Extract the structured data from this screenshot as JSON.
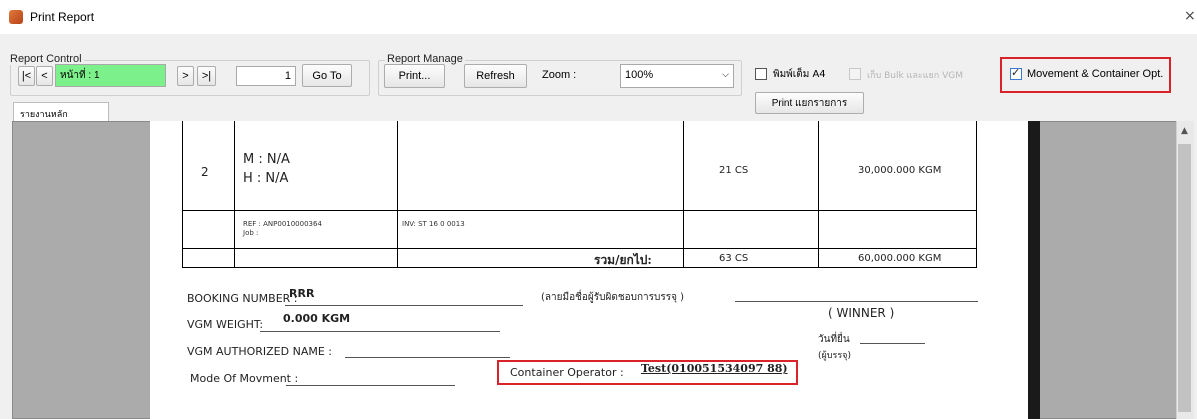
{
  "window": {
    "title": "Print Report",
    "close_glyph": "×"
  },
  "report_control": {
    "title": "Report Control",
    "first_glyph": "|<",
    "prev_glyph": "<",
    "next_glyph": ">",
    "last_glyph": ">|",
    "page_label": "หน้าที่ : 1",
    "page_input": "1",
    "goto_label": "Go To"
  },
  "report_manage": {
    "title": "Report Manage",
    "print_label": "Print...",
    "refresh_label": "Refresh",
    "zoom_label": "Zoom :",
    "zoom_value": "100%"
  },
  "options": {
    "a4_label": "พิมพ์เต็ม A4",
    "bulk_label": "เก็บ Bulk และแยก VGM",
    "print_list_label": "Print แยกรายการ",
    "movement_label": "Movement & Container Opt."
  },
  "tab": {
    "label": "รายงานหลัก"
  },
  "document": {
    "row_no": "2",
    "m_text": "M : N/A",
    "h_text": "H : N/A",
    "row_qty": "21  CS",
    "row_weight": "30,000.000  KGM",
    "ref_text": "REF : ANP0010000364",
    "job_text": "Job :",
    "inv_text": "INV: ST 16 0 0013",
    "total_label": "รวม/ยกไป:",
    "total_qty": "63  CS",
    "total_weight": "60,000.000  KGM",
    "booking_label": "BOOKING NUMBER :",
    "booking_value": "RRR",
    "vgm_weight_label": "VGM WEIGHT:",
    "vgm_weight_value": "0.000 KGM",
    "vgm_auth_label": "VGM AUTHORIZED NAME :",
    "mode_label": "Mode Of Movment :",
    "signature_label": "(ลายมือชื่อผู้รับผิดชอบการบรรจุ )",
    "winner": "(    WINNER    )",
    "date_label": "วันที่ยื่น",
    "stuffer_label": "(ผู้บรรจุ)",
    "container_operator_label": "Container Operator :",
    "container_operator_value": "Test(010051534097 88)"
  },
  "colors": {
    "page_indicator": "#7cf08a",
    "highlight": "#d8232a"
  }
}
